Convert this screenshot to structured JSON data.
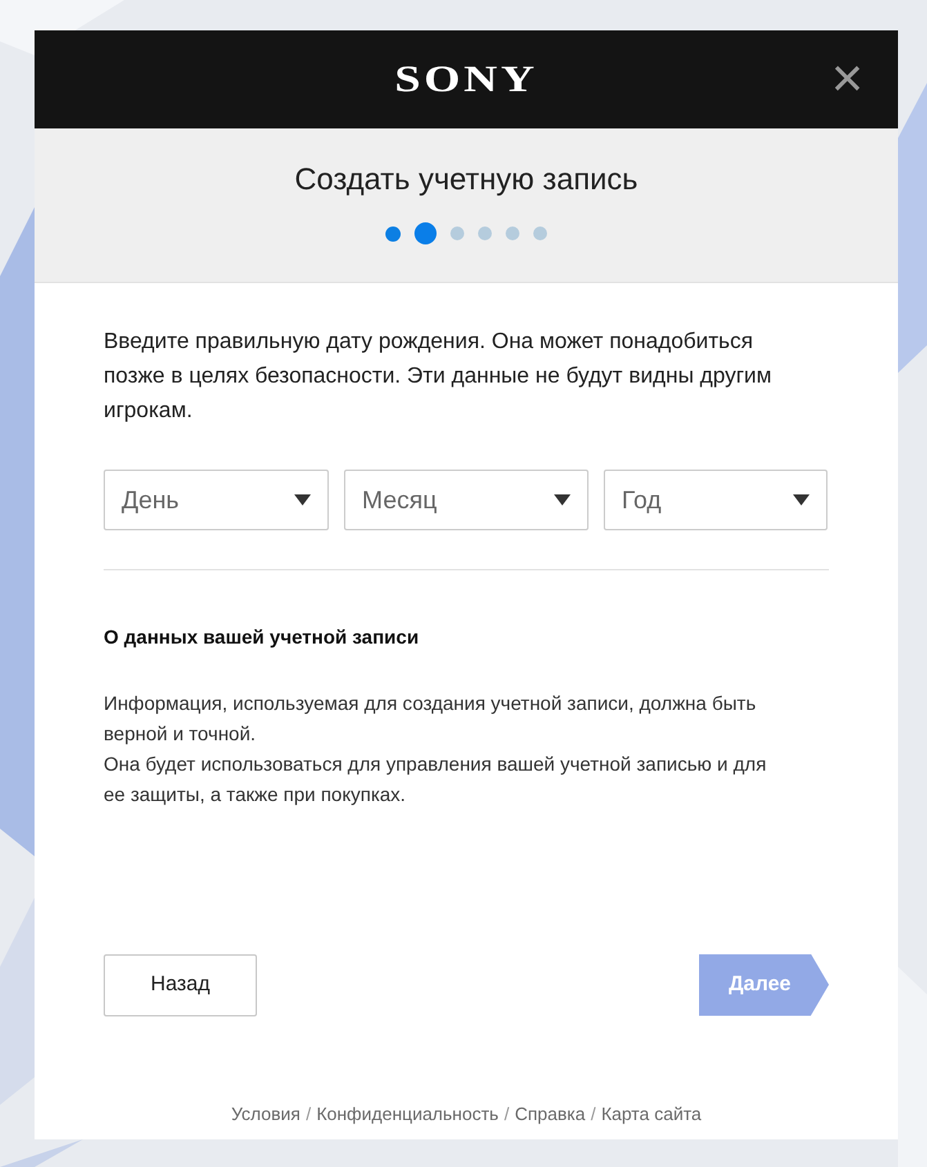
{
  "header": {
    "logo": "SONY",
    "close": "×"
  },
  "title": "Создать учетную запись",
  "steps": [
    {
      "completed": true,
      "selected": false
    },
    {
      "completed": false,
      "selected": true
    },
    {
      "completed": false,
      "selected": false
    },
    {
      "completed": false,
      "selected": false
    },
    {
      "completed": false,
      "selected": false
    },
    {
      "completed": false,
      "selected": false
    }
  ],
  "intro": "Введите правильную дату рождения. Она может понадобиться позже в целях безопасности. Эти данные не будут видны другим игрокам.",
  "date_fields": [
    {
      "placeholder": "День"
    },
    {
      "placeholder": "Месяц"
    },
    {
      "placeholder": "Год"
    }
  ],
  "info": {
    "heading": "О данных вашей учетной записи",
    "lines": [
      "Информация, используемая для создания учетной записи, должна быть верной и точной.",
      "Она будет использоваться для управления вашей учетной записью и для ее защиты, а также при покупках."
    ]
  },
  "buttons": {
    "back": {
      "label": "Назад"
    },
    "next": {
      "label": "Далее",
      "disabled": true
    }
  },
  "footer": [
    {
      "kind": "link",
      "text": "Условия"
    },
    {
      "kind": "separator",
      "text": "/"
    },
    {
      "kind": "link",
      "text": "Конфиденциальность"
    },
    {
      "kind": "separator",
      "text": "/"
    },
    {
      "kind": "link",
      "text": "Справка"
    },
    {
      "kind": "separator",
      "text": "/"
    },
    {
      "kind": "link",
      "text": "Карта сайта"
    }
  ]
}
